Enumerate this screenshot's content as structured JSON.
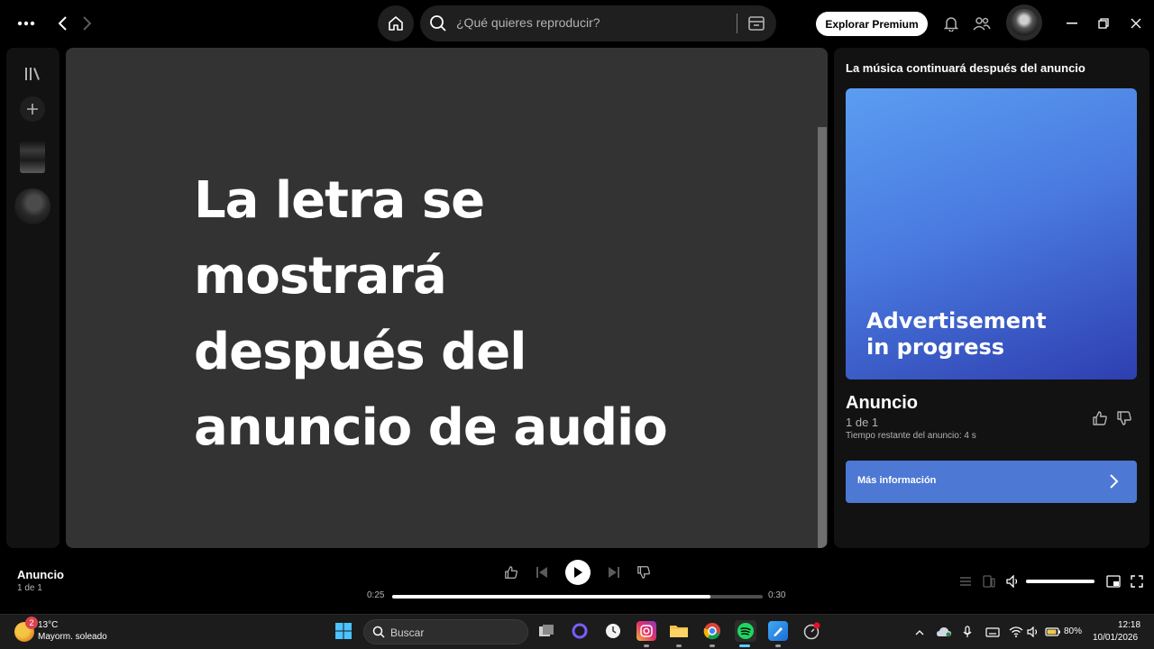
{
  "topbar": {
    "menu_icon": "more-dots-icon",
    "search_placeholder": "¿Qué quieres reproducir?",
    "premium_label": "Explorar Premium"
  },
  "sidebar": {
    "icons": [
      "library-icon",
      "plus-icon"
    ]
  },
  "main": {
    "lyrics_lines": [
      "La letra se mostrará",
      "después del",
      "anuncio de audio"
    ]
  },
  "right_panel": {
    "header": "La música continuará después del anuncio",
    "ad_card_text_line1": "Advertisement",
    "ad_card_text_line2": "in progress",
    "title": "Anuncio",
    "subtitle": "1 de 1",
    "remaining": "Tiempo restante del anuncio: 4 s",
    "more_info_label": "Más información",
    "colors": {
      "card_top": "#5b9df2",
      "card_bottom": "#2e3fb0",
      "button": "#4d78d4"
    }
  },
  "player": {
    "title": "Anuncio",
    "subtitle": "1 de 1",
    "elapsed": "0:25",
    "duration": "0:30",
    "progress_fraction": 0.86,
    "volume_fraction": 1.0
  },
  "taskbar": {
    "weather_temp": "13°C",
    "weather_condition": "Mayorm. soleado",
    "weather_badge": "2",
    "search_label": "Buscar",
    "battery": "80%",
    "time": "12:18",
    "date": "10/01/2026"
  }
}
